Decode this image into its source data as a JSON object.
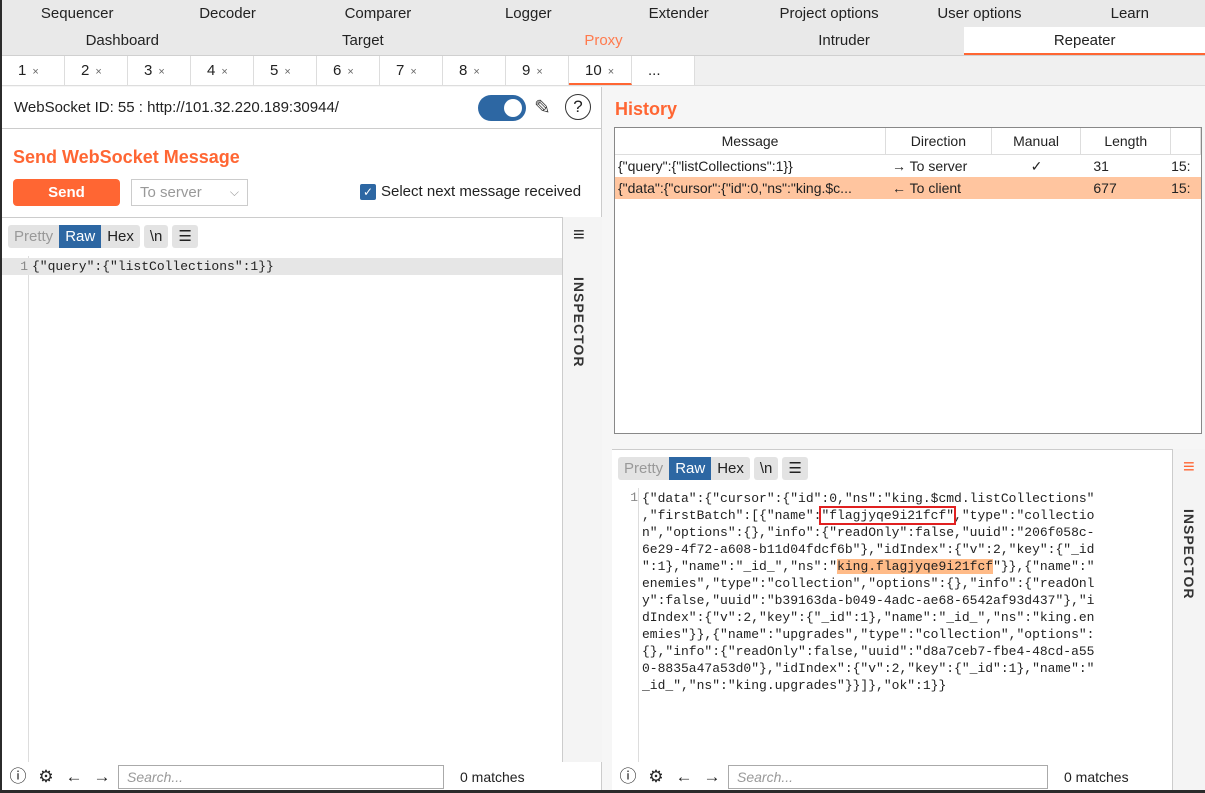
{
  "nav": {
    "row1": [
      "Sequencer",
      "Decoder",
      "Comparer",
      "Logger",
      "Extender",
      "Project options",
      "User options",
      "Learn"
    ],
    "row2": [
      "Dashboard",
      "Target",
      "Proxy",
      "Intruder",
      "Repeater"
    ]
  },
  "tabs": [
    "1",
    "2",
    "3",
    "4",
    "5",
    "6",
    "7",
    "8",
    "9",
    "10",
    "..."
  ],
  "active_tab": "10",
  "websocket": {
    "label": "WebSocket ID: 55 : http://101.32.220.189:30944/",
    "intercept_on": true
  },
  "send": {
    "title": "Send WebSocket Message",
    "button": "Send",
    "direction": "To server",
    "select_next_label": "Select next message received",
    "select_next_checked": true
  },
  "format": {
    "pretty": "Pretty",
    "raw": "Raw",
    "hex": "Hex",
    "newline": "\\n",
    "selected": "Raw"
  },
  "request": {
    "lines": [
      "{\"query\":{\"listCollections\":1}}"
    ]
  },
  "inspector": "INSPECTOR",
  "history": {
    "title": "History",
    "columns": [
      "Message",
      "Direction",
      "Manual",
      "Length",
      ""
    ],
    "rows": [
      {
        "message": "{\"query\":{\"listCollections\":1}}",
        "direction": "→ To server",
        "manual": "✓",
        "length": "31",
        "time": "15:"
      },
      {
        "message": "{\"data\":{\"cursor\":{\"id\":0,\"ns\":\"king.$c...",
        "direction": "← To client",
        "manual": "",
        "length": "677",
        "time": "15:"
      }
    ]
  },
  "response": {
    "lines": [
      "{\"data\":{\"cursor\":{\"id\":0,\"ns\":\"king.$cmd.listCollections\"",
      ",\"firstBatch\":[{\"name\":\"flagjyqe9i21fcf\",\"type\":\"collectio",
      "n\",\"options\":{},\"info\":{\"readOnly\":false,\"uuid\":\"206f058c-",
      "6e29-4f72-a608-b11d04fdcf6b\"},\"idIndex\":{\"v\":2,\"key\":{\"_id",
      "\":1},\"name\":\"_id_\",\"ns\":\"king.flagjyqe9i21fcf\"}},{\"name\":\"",
      "enemies\",\"type\":\"collection\",\"options\":{},\"info\":{\"readOnl",
      "y\":false,\"uuid\":\"b39163da-b049-4adc-ae68-6542af93d437\"},\"i",
      "dIndex\":{\"v\":2,\"key\":{\"_id\":1},\"name\":\"_id_\",\"ns\":\"king.en",
      "emies\"}},{\"name\":\"upgrades\",\"type\":\"collection\",\"options\":",
      "{},\"info\":{\"readOnly\":false,\"uuid\":\"d8a7ceb7-fbe4-48cd-a55",
      "0-8835a47a53d0\"},\"idIndex\":{\"v\":2,\"key\":{\"_id\":1},\"name\":\"",
      "_id_\",\"ns\":\"king.upgrades\"}}]},\"ok\":1}}"
    ],
    "boxed": "\"flagjyqe9i21fcf\"",
    "highlighted": "king.flagjyqe9i21fcf"
  },
  "search": {
    "placeholder": "Search...",
    "matches_left": "0 matches",
    "matches_right": "0 matches"
  },
  "colors": {
    "accent": "#ff6633",
    "selected_row": "#ffc59f",
    "blue": "#2d67a3"
  }
}
